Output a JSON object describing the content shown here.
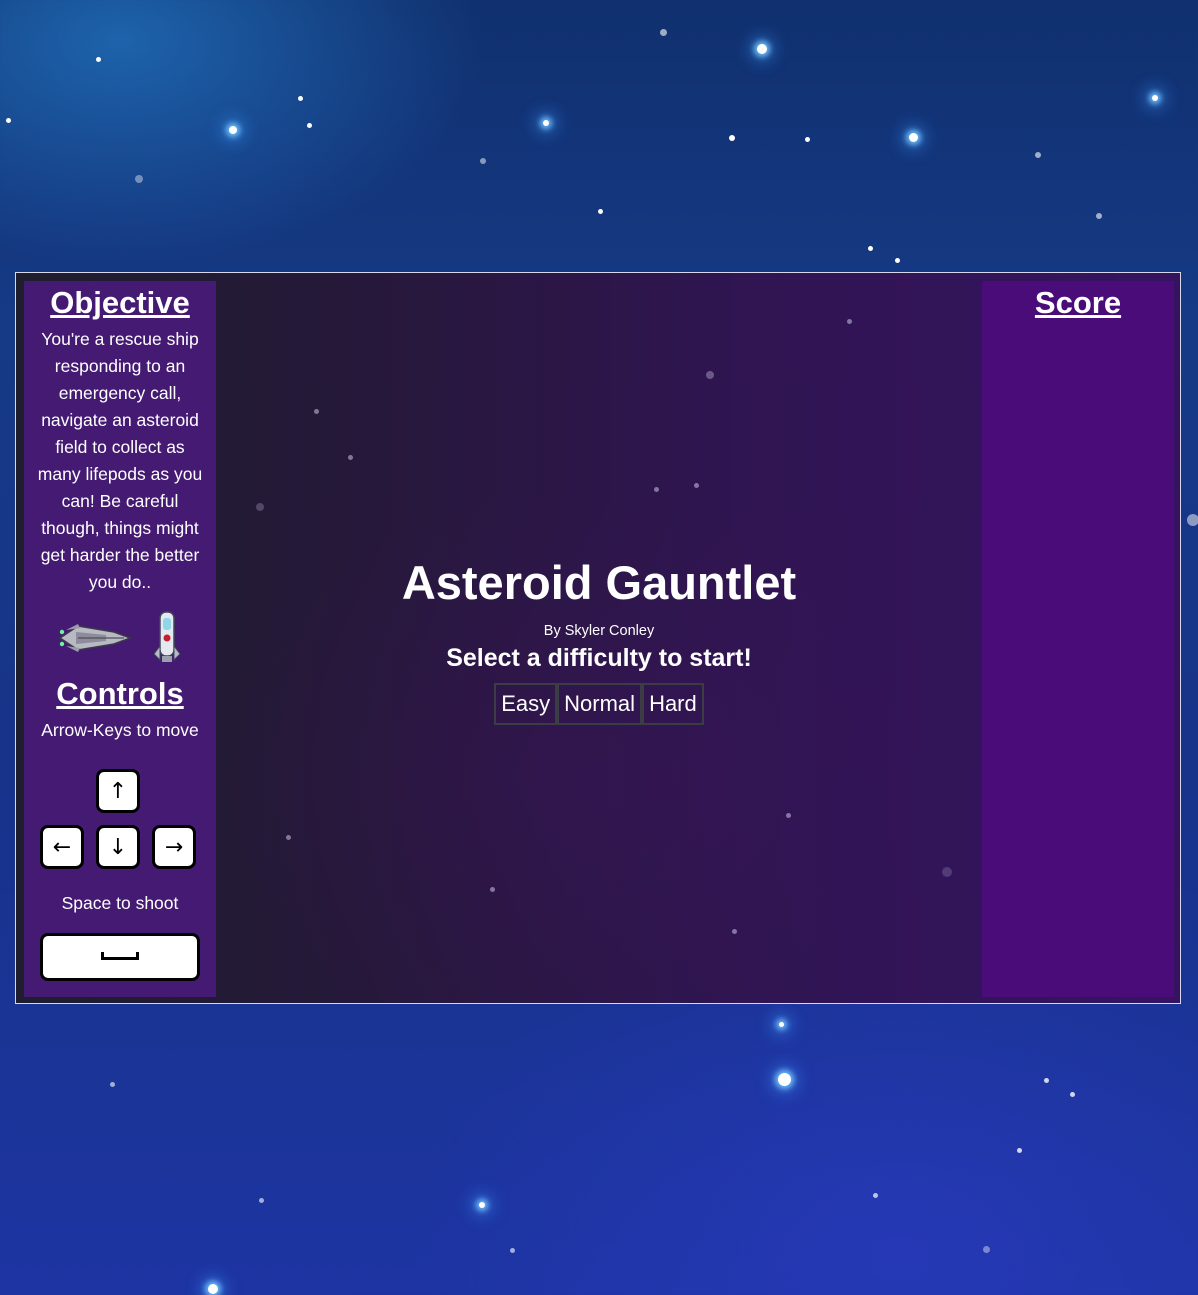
{
  "objective": {
    "heading": "Objective",
    "text": "You're a rescue ship responding to an emergency call, navigate an asteroid field to collect as many lifepods as you can! Be careful though, things might get harder the better you do.."
  },
  "controls": {
    "heading": "Controls",
    "move_text": "Arrow-Keys to move",
    "shoot_text": "Space to shoot",
    "keys": {
      "up": "↑",
      "left": "←",
      "down": "↓",
      "right": "→"
    }
  },
  "score": {
    "heading": "Score"
  },
  "start_screen": {
    "title": "Asteroid Gauntlet",
    "byline": "By Skyler Conley",
    "prompt": "Select a difficulty to start!",
    "difficulties": [
      "Easy",
      "Normal",
      "Hard"
    ]
  },
  "sprites": [
    "rescue-ship-icon",
    "lifepod-icon"
  ],
  "colors": {
    "sidebar_left": "#451a72",
    "sidebar_right": "#4a0c79",
    "frame_border": "#d8d8e8"
  }
}
